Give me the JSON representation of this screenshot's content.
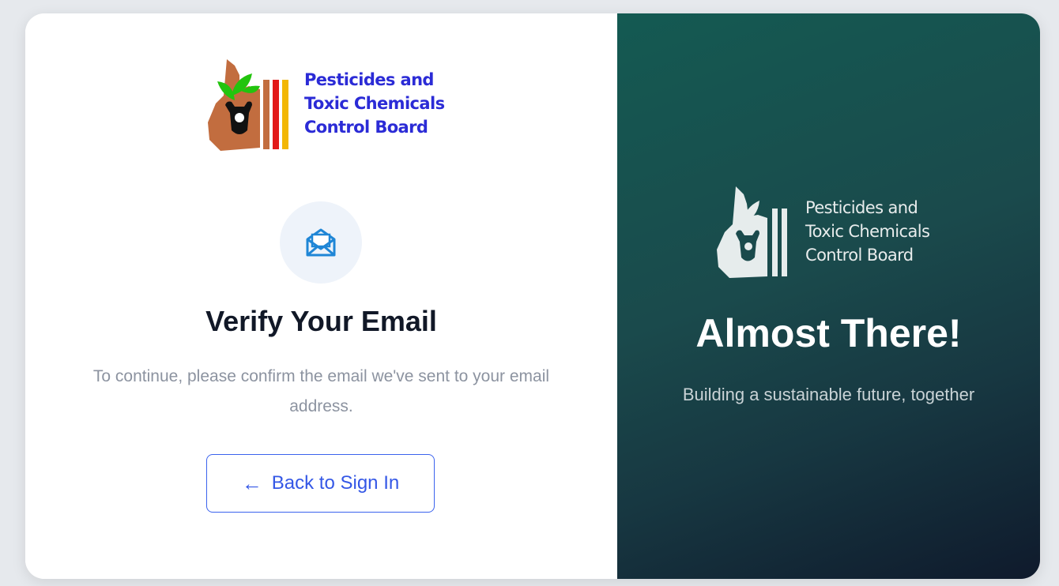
{
  "brand": {
    "name_lines": [
      "Pesticides and",
      "Toxic Chemicals",
      "Control Board"
    ],
    "colors": {
      "name_text": "#2b2bd6",
      "leaf": "#22c40e",
      "hand": "#c26d3f",
      "red_bar": "#e21a1a",
      "yellow_bar": "#f2b705"
    }
  },
  "verify": {
    "icon": "envelope-open-icon",
    "title": "Verify Your Email",
    "message": "To continue, please confirm the email we've sent to your email address.",
    "back_button": {
      "arrow": "←",
      "label": "Back to Sign In"
    }
  },
  "promo": {
    "title": "Almost There!",
    "subtitle": "Building a sustainable future, together"
  },
  "colors": {
    "accent": "#3b63ee",
    "panel_gradient": [
      "#145a52",
      "#0f1a2c"
    ]
  }
}
